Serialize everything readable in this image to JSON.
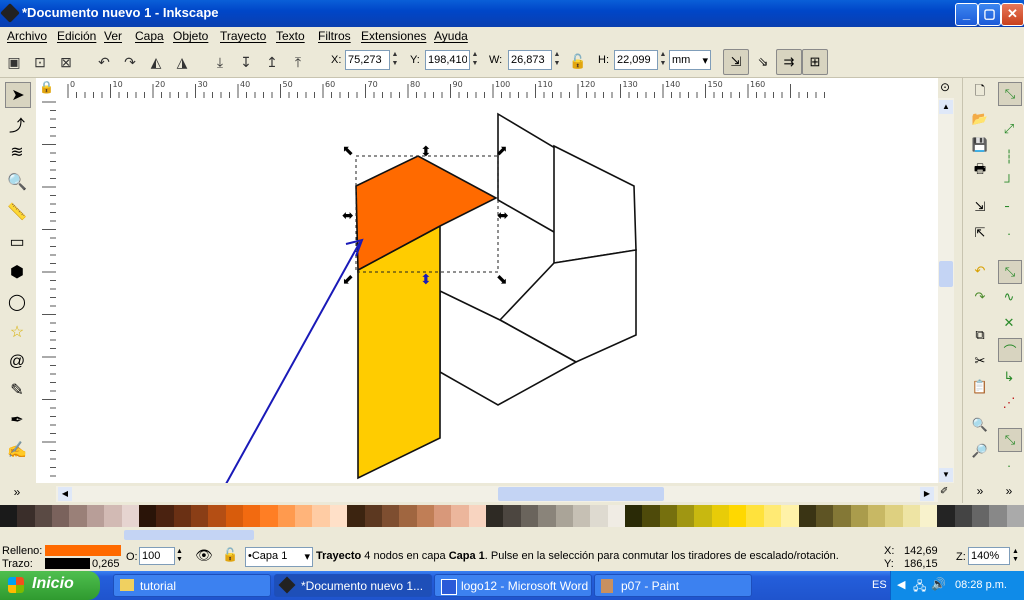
{
  "window": {
    "title": "*Documento nuevo 1 - Inkscape",
    "minimize": "_",
    "maximize": "▢",
    "close": "✕"
  },
  "menu": [
    "Archivo",
    "Edición",
    "Ver",
    "Capa",
    "Objeto",
    "Trayecto",
    "Texto",
    "Filtros",
    "Extensiones",
    "Ayuda"
  ],
  "toolbar": {
    "x_label": "X:",
    "x_value": "75,273",
    "y_label": "Y:",
    "y_value": "198,410",
    "w_label": "W:",
    "w_value": "26,873",
    "h_label": "H:",
    "h_value": "22,099",
    "unit": "mm"
  },
  "ruler": {
    "top_ticks": [
      "0",
      "10",
      "20",
      "30",
      "40",
      "50",
      "60",
      "70",
      "80",
      "90",
      "100",
      "110",
      "120",
      "130",
      "140",
      "150",
      "160"
    ]
  },
  "palette": [
    "#1a1a1a",
    "#3a2e2a",
    "#5a4a44",
    "#7a625c",
    "#9a8078",
    "#b89e98",
    "#d2bab4",
    "#e6d4d0",
    "#2a1408",
    "#4a2210",
    "#6a3014",
    "#8a3e16",
    "#b44e14",
    "#d85c0c",
    "#f26a10",
    "#ff7e24",
    "#ff9a4e",
    "#ffb47a",
    "#ffcca4",
    "#ffe0c8",
    "#3c2410",
    "#5c3820",
    "#7e4e30",
    "#a06640",
    "#c07e56",
    "#d8987a",
    "#ecb69c",
    "#f8d4c0",
    "#2e2a24",
    "#4c4640",
    "#6a645c",
    "#8a847a",
    "#aaa498",
    "#c6c0b4",
    "#dedad0",
    "#f0ece4",
    "#2a2a06",
    "#4e4a0a",
    "#76700e",
    "#a09612",
    "#c8b810",
    "#e8cc08",
    "#ffd800",
    "#ffe23c",
    "#ffea74",
    "#fff2a8",
    "#3a3414",
    "#5e5424",
    "#847836",
    "#aa9c4c",
    "#c8b864",
    "#ded080",
    "#eee4a4",
    "#f8f2cc",
    "#242424",
    "#444444",
    "#666666",
    "#888888",
    "#aaaaaa"
  ],
  "status": {
    "fill_label": "Relleno:",
    "fill_color": "#ff6a00",
    "stroke_label": "Trazo:",
    "stroke_width": "0,265",
    "opacity_label": "O:",
    "opacity_value": "100",
    "layer": "•Capa 1",
    "msg_bold1": "Trayecto",
    "msg_text1": " 4 nodos en capa ",
    "msg_bold2": "Capa 1",
    "msg_text2": ". Pulse en la selección para conmutar los tiradores de escalado/rotación.",
    "coord_x_label": "X:",
    "coord_x": "142,69",
    "coord_y_label": "Y:",
    "coord_y": "186,15",
    "zoom_label": "Z:",
    "zoom_value": "140%"
  },
  "taskbar": {
    "start": "Inicio",
    "tasks": [
      "tutorial",
      "*Documento nuevo 1...",
      "logo12 - Microsoft Word",
      "p07 - Paint"
    ],
    "lang": "ES",
    "clock": "08:28 p.m."
  },
  "colors": {
    "orange": "#ff6a00",
    "yellow": "#ffcc00",
    "arrow": "#1a1ab8"
  }
}
